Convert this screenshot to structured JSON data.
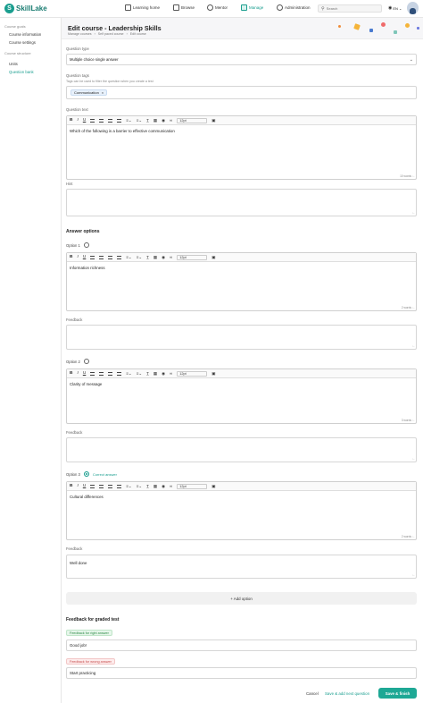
{
  "brand": {
    "name": "SkillLake"
  },
  "nav": [
    {
      "label": "Learning home"
    },
    {
      "label": "Browse"
    },
    {
      "label": "Mentor"
    },
    {
      "label": "Manage"
    },
    {
      "label": "Administration"
    }
  ],
  "search": {
    "placeholder": "Search"
  },
  "language": {
    "label": "EN"
  },
  "sidebar": {
    "course_goals_heading": "Course goals",
    "course_information": "Course information",
    "course_settings": "Course settings",
    "course_structure_heading": "Course structure",
    "units": "Units",
    "question_bank": "Question bank"
  },
  "header": {
    "title": "Edit course - Leadership Skills",
    "breadcrumbs": [
      "Manage courses",
      "Self paced course",
      "Edit course"
    ]
  },
  "form": {
    "question_type_label": "Question type",
    "question_type_value": "Multiple choice single answer",
    "question_tags_label": "Question tags",
    "question_tags_hint": "Tags can be used to filter the question when you create a test",
    "tag": "Communication",
    "question_text_label": "Question text",
    "question_text": "Which of the following is a barrier to effective communication",
    "question_word_count": "10 words",
    "hint_label": "Hint",
    "answer_options_title": "Answer options",
    "feedback_label": "Feedback",
    "font_size": "12pt",
    "options": [
      {
        "label": "Option 1",
        "text": "Information richness",
        "word_count": "2 words",
        "feedback": "",
        "correct": false
      },
      {
        "label": "Option 2",
        "text": "Clarity of message",
        "word_count": "3 words",
        "feedback": "",
        "correct": false
      },
      {
        "label": "Option 3",
        "text": "Cultural differences",
        "word_count": "2 words",
        "feedback": "Well done",
        "correct": true
      }
    ],
    "correct_answer_label": "Correct answer",
    "add_option": "+ Add option",
    "graded_feedback_title": "Feedback for graded test",
    "right_answer_label": "Feedback for right answer",
    "right_answer_value": "Good job!",
    "wrong_answer_label": "Feedback for wrong answer",
    "wrong_answer_value": "Start practicing"
  },
  "footer": {
    "cancel": "Cancel",
    "save_add_next": "Save & add next question",
    "save_finish": "Save & finish"
  },
  "colors": {
    "accent": "#1ea895",
    "brand": "#1a7d72"
  }
}
